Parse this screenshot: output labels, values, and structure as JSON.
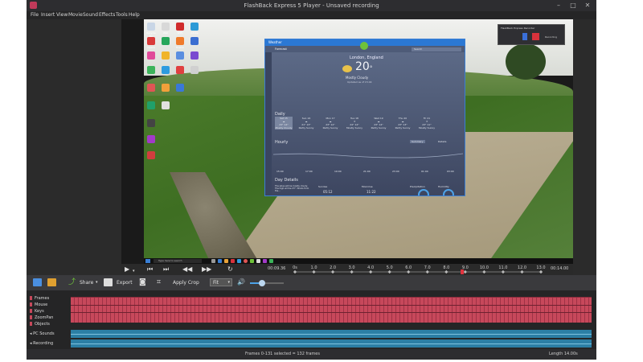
{
  "window": {
    "title": "FlashBack Express 5 Player - Unsaved recording",
    "minimize": "–",
    "maximize": "□",
    "close": "✕"
  },
  "menu": [
    "File",
    "Insert",
    "View",
    "Movie",
    "Sound",
    "Effects",
    "Tools",
    "Help"
  ],
  "desktop_icons": [
    {
      "label": "Recycle Bin",
      "color": "#c9d6e6"
    },
    {
      "label": "Wall",
      "color": "#d8d8d8"
    },
    {
      "label": "WPS",
      "color": "#d02b2b"
    },
    {
      "label": "Adobe",
      "color": "#2d9ad6"
    },
    {
      "label": "Opera",
      "color": "#d93a3a"
    },
    {
      "label": "",
      "color": "#26a65b"
    },
    {
      "label": "Firefox",
      "color": "#ef7a2b"
    },
    {
      "label": "",
      "color": "#3b6ed1"
    }
  ],
  "taskbar": {
    "search_placeholder": "Type here to search"
  },
  "weather": {
    "app_title": "Weather",
    "nav_label": "Forecast",
    "search_placeholder": "Search",
    "location": "London, England",
    "temperature": "20",
    "unit": "°",
    "condition": "Mostly Cloudy",
    "updated": "Updated as of 15:44",
    "daily_label": "Daily",
    "days": [
      {
        "name": "Sat 15",
        "temps": "23° 14°",
        "cond": "Mostly Cloudy"
      },
      {
        "name": "Sun 16",
        "temps": "21° 13°",
        "cond": "Partly Sunny"
      },
      {
        "name": "Mon 17",
        "temps": "23° 12°",
        "cond": "Partly Sunny"
      },
      {
        "name": "Tue 18",
        "temps": "24° 14°",
        "cond": "Mostly Sunny"
      },
      {
        "name": "Wed 19",
        "temps": "23° 14°",
        "cond": "Partly Sunny"
      },
      {
        "name": "Thu 20",
        "temps": "23° 13°",
        "cond": "Partly Sunny"
      },
      {
        "name": "Fri 21",
        "temps": "23° 11°",
        "cond": "Mostly Sunny"
      }
    ],
    "hourly_label": "Hourly",
    "hourly_btn_summary": "Summary",
    "hourly_btn_details": "Details",
    "hours": [
      "15:00",
      "17:00",
      "19:00",
      "21:00",
      "23:00",
      "01:00",
      "03:00"
    ],
    "day_details_label": "Day Details",
    "day_details_text": "The skies will be mostly cloudy. The high will be 23°. Winds from the...",
    "details": [
      {
        "label": "Sunrise",
        "value": "05:12"
      },
      {
        "label": "Moonrise",
        "value": "11:22"
      },
      {
        "label": "Precipitation",
        "value": ""
      },
      {
        "label": "Humidity",
        "value": ""
      }
    ]
  },
  "recorder": {
    "title": "FlashBack Express Recorder",
    "label": "Recording"
  },
  "player": {
    "current_time": "00:09.36",
    "end_time": "00:14.00",
    "ruler": [
      "0s",
      "1.0",
      "2.0",
      "3.0",
      "4.0",
      "5.0",
      "6.0",
      "7.0",
      "8.0",
      "9.0",
      "10.0",
      "11.0",
      "12.0",
      "13.0"
    ],
    "playhead_fraction": 0.68
  },
  "toolbar": {
    "share": "Share",
    "export": "Export",
    "apply_crop": "Apply Crop",
    "zoom": "Fit",
    "volume_fraction": 0.35
  },
  "timeline": {
    "frames_label": "Frames",
    "mouse_label": "Mouse",
    "keys_label": "Keys",
    "zoompan_label": "ZoomPan",
    "objects_label": "Objects",
    "pc_sounds_label": "PC Sounds",
    "recording_label": "Recording"
  },
  "status": {
    "selection": "Frames 0-131 selected = 132 frames",
    "length": "Length 14.00s"
  },
  "colors": {
    "accent": "#2b78d4",
    "frames": "#c7485b",
    "sound": "#2c7fa5",
    "playhead": "#e2343f"
  }
}
